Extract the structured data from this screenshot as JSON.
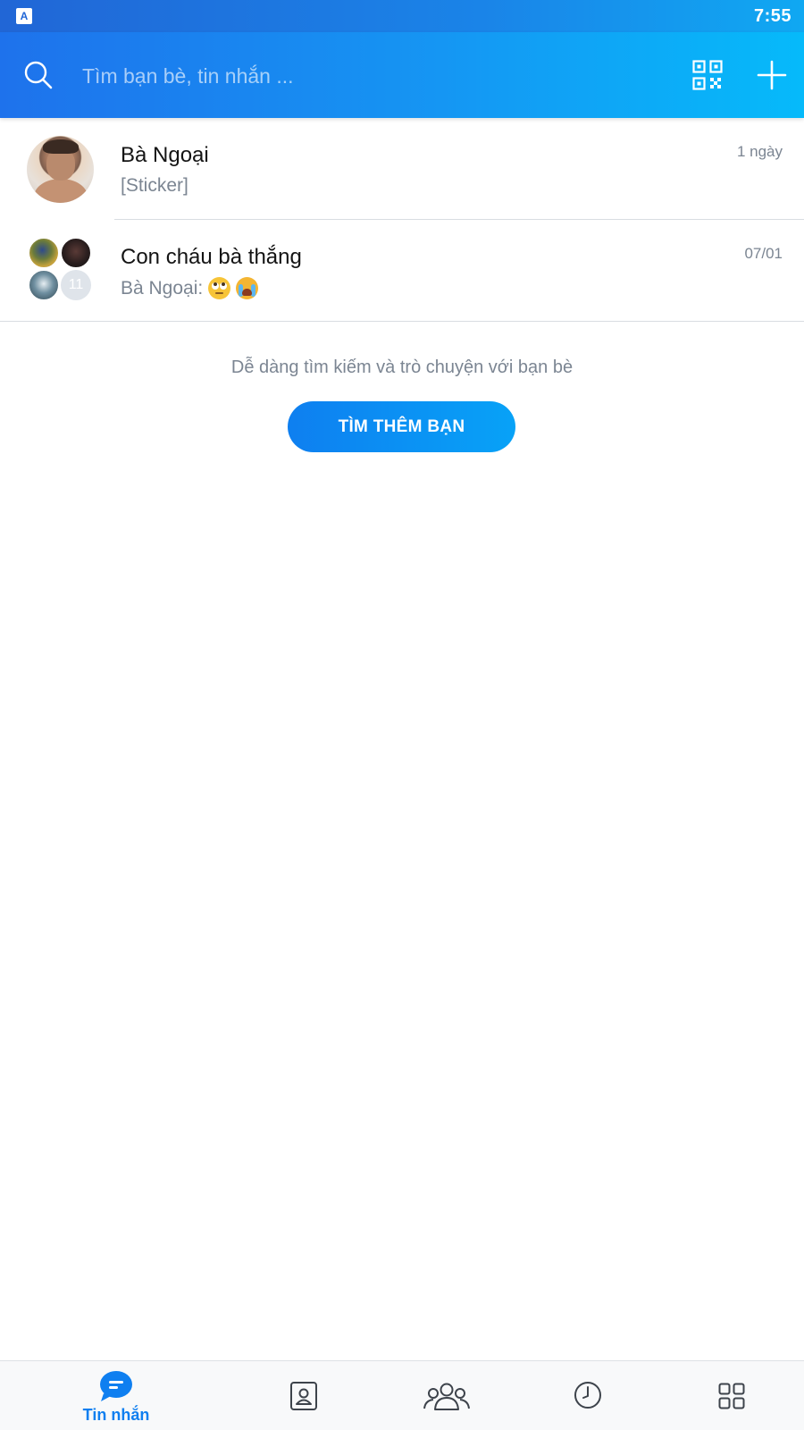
{
  "status_bar": {
    "app_icon": "A",
    "time": "7:55"
  },
  "header": {
    "search_placeholder": "Tìm bạn bè, tin nhắn ...",
    "icons": [
      "search-icon",
      "qr-code-icon",
      "add-icon"
    ]
  },
  "conversations": [
    {
      "name": "Bà Ngoại",
      "preview": "[Sticker]",
      "time": "1 ngày",
      "avatar": "single"
    },
    {
      "name": "Con cháu bà thắng",
      "preview": "Bà Ngoại:",
      "preview_emojis": [
        "rolling-eyes-emoji",
        "crying-emoji"
      ],
      "time": "07/01",
      "avatar": "group",
      "member_count": "11"
    }
  ],
  "empty_hint": "Dễ dàng tìm kiếm và trò chuyện với bạn bè",
  "find_friends_button": "TÌM THÊM BẠN",
  "bottom_nav": {
    "active_tab": "messages",
    "messages_label": "Tin nhắn",
    "tabs": [
      "messages-tab",
      "contacts-tab",
      "groups-tab",
      "timeline-tab",
      "more-tab"
    ]
  },
  "colors": {
    "accent": "#0f7ff0",
    "header_start": "#1e72ec",
    "header_end": "#06bafa",
    "muted_text": "#7b8592"
  }
}
